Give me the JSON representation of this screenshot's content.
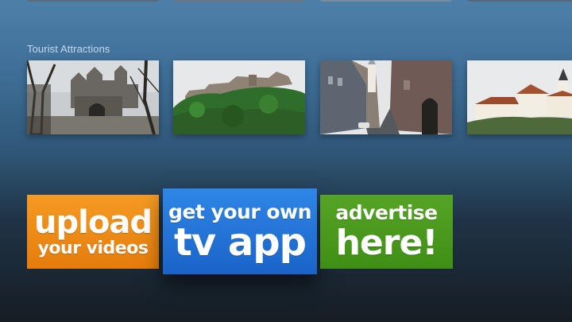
{
  "section": {
    "title": "Tourist Attractions"
  },
  "thumbnails": [
    {
      "scene": "castle-gate-bare-trees"
    },
    {
      "scene": "castle-on-green-hill"
    },
    {
      "scene": "narrow-street-church-tower"
    },
    {
      "scene": "white-castle-on-hill"
    }
  ],
  "promos": {
    "upload": {
      "line1": "upload",
      "line2": "your videos",
      "color": "#f0901a"
    },
    "tvapp": {
      "line1": "get your own",
      "line2": "tv app",
      "color": "#2478da"
    },
    "advertise": {
      "line1": "advertise",
      "line2": "here!",
      "color": "#4f9d1f"
    }
  },
  "colors": {
    "background_top": "#4d7fa9",
    "background_bottom": "#161d24"
  }
}
